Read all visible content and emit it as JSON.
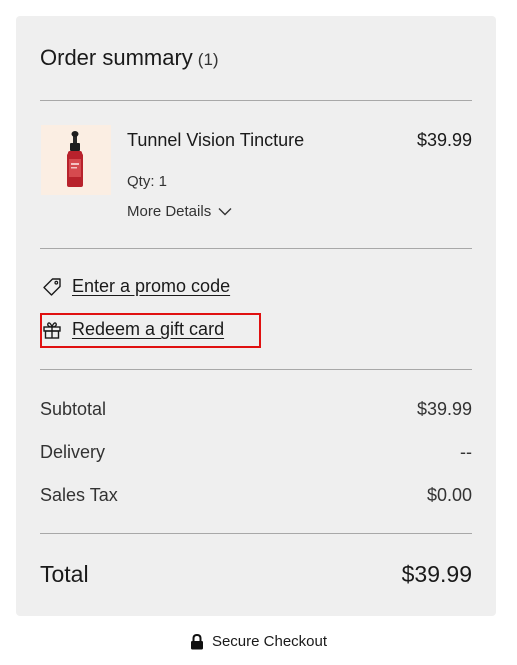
{
  "summary": {
    "title": "Order summary",
    "item_count": "(1)"
  },
  "product": {
    "name": "Tunnel Vision Tincture",
    "price": "$39.99",
    "qty": "Qty: 1",
    "more_details": "More Details"
  },
  "actions": {
    "promo": "Enter a promo code",
    "gift_card": "Redeem a gift card"
  },
  "totals": {
    "subtotal_label": "Subtotal",
    "subtotal_value": "$39.99",
    "delivery_label": "Delivery",
    "delivery_value": "--",
    "tax_label": "Sales Tax",
    "tax_value": "$0.00",
    "total_label": "Total",
    "total_value": "$39.99"
  },
  "footer": {
    "secure_checkout": "Secure Checkout"
  },
  "colors": {
    "card_background": "#efefef",
    "highlight": "#e01010",
    "thumbnail_background": "#fbeee3",
    "bottle": "#b8222c"
  },
  "icons": {
    "promo": "tag-icon",
    "gift_card": "gift-icon",
    "more_details": "chevron-down-icon",
    "secure": "lock-icon"
  }
}
